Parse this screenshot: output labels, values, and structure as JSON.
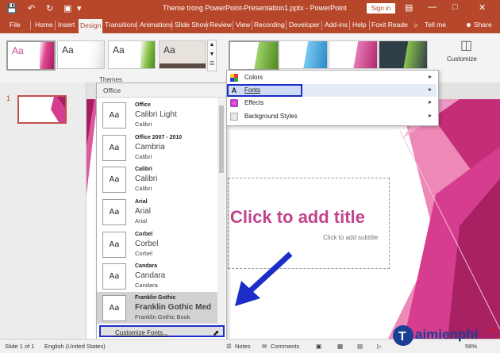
{
  "window": {
    "title": "Theme trong PowerPoint-Presentation1.pptx - PowerPoint",
    "sign_in": "Sign in"
  },
  "tabs": [
    "File",
    "Home",
    "Insert",
    "Design",
    "Transitions",
    "Animations",
    "Slide Show",
    "Review",
    "View",
    "Recording",
    "Developer",
    "Add-ins",
    "Help",
    "Foxit Reade",
    "Tell me",
    "Share"
  ],
  "ribbon": {
    "themes_group_label": "Themes",
    "theme_thumb_text": "Aa",
    "customize_label": "Customize"
  },
  "gallery": {
    "header": "Office",
    "box_text": "Aa",
    "items": [
      {
        "name": "Office",
        "heading": "Calibri Light",
        "body": "Calibri"
      },
      {
        "name": "Office 2007 - 2010",
        "heading": "Cambria",
        "body": "Calibri"
      },
      {
        "name": "Calibri",
        "heading": "Calibri",
        "body": "Calibri"
      },
      {
        "name": "Arial",
        "heading": "Arial",
        "body": "Arial"
      },
      {
        "name": "Corbel",
        "heading": "Corbel",
        "body": "Corbel"
      },
      {
        "name": "Candara",
        "heading": "Candara",
        "body": "Candara"
      },
      {
        "name": "Franklin Gothic",
        "heading": "Franklin Gothic Med",
        "body": "Franklin Gothic Book"
      }
    ],
    "customize": "Customize Fonts..."
  },
  "variants_menu": {
    "items": [
      {
        "label": "Colors"
      },
      {
        "label": "Fonts"
      },
      {
        "label": "Effects"
      },
      {
        "label": "Background Styles"
      }
    ]
  },
  "slides": {
    "number": "1",
    "title_placeholder": "Click to add title",
    "subtitle_placeholder": "Click to add subtitle"
  },
  "statusbar": {
    "slide_info": "Slide 1 of 1",
    "language": "English (United States)",
    "notes": "Notes",
    "comments": "Comments",
    "zoom": "58%"
  },
  "watermark": {
    "text": "aimienphi",
    "suffix": ".vn"
  },
  "colors": {
    "accent": "#b7472a",
    "slide_pink": "#d63d8f",
    "highlight_border": "#1c2cc7"
  }
}
